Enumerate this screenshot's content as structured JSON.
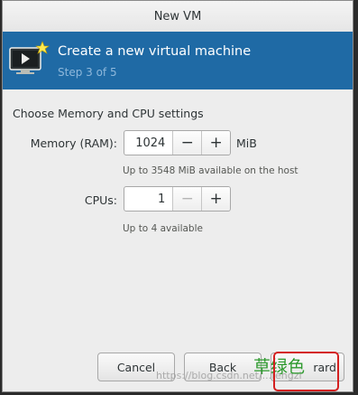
{
  "window": {
    "title": "New VM"
  },
  "banner": {
    "title": "Create a new virtual machine",
    "step": "Step 3 of 5",
    "icon": "monitor-with-star-icon",
    "color": "#1f6aa5"
  },
  "section": {
    "label": "Choose Memory and CPU settings"
  },
  "memory": {
    "label": "Memory (RAM):",
    "value": "1024",
    "decrement": "−",
    "increment": "+",
    "unit": "MiB",
    "hint": "Up to 3548 MiB available on the host"
  },
  "cpus": {
    "label": "CPUs:",
    "value": "1",
    "decrement": "−",
    "increment": "+",
    "hint": "Up to 4 available"
  },
  "buttons": {
    "cancel": "Cancel",
    "back": "Back",
    "forward": "rard"
  },
  "overlay": {
    "annotation": "草绿色",
    "watermark": "https://blog.csdn.net/...fengzi",
    "annotation_color": "#2e9a2e",
    "highlight_color": "#d42020"
  }
}
